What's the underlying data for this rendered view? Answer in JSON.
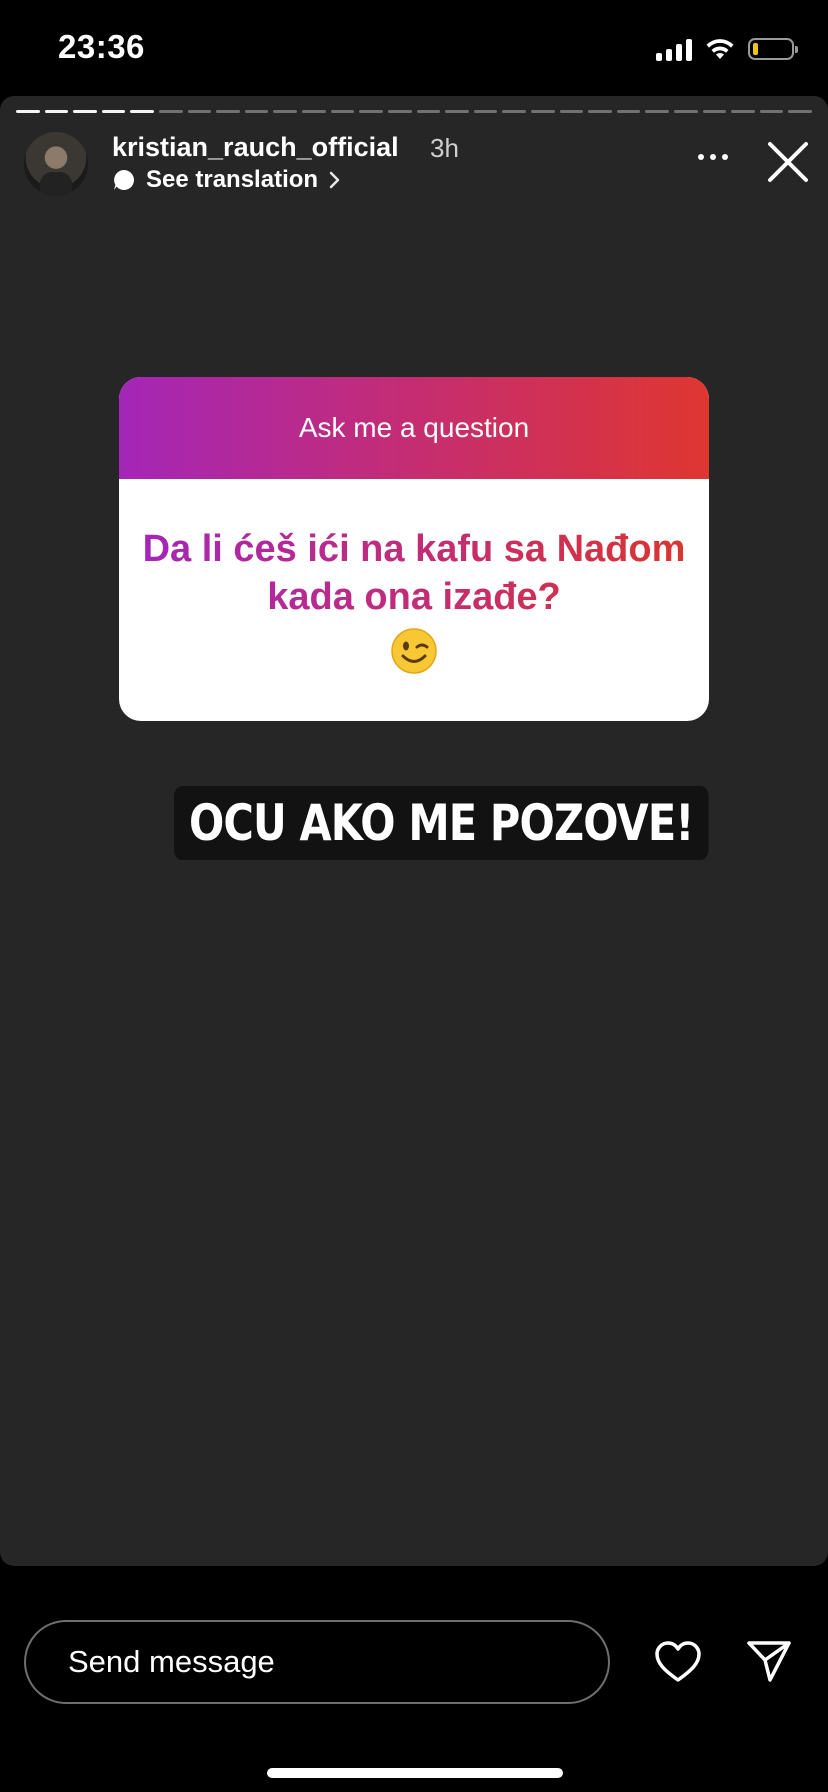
{
  "status_bar": {
    "time": "23:36",
    "icons": [
      "cellular-signal-icon",
      "wifi-icon",
      "battery-icon"
    ]
  },
  "story": {
    "progress_segments": 28,
    "progress_completed": 5,
    "user": {
      "username": "kristian_rauch_official",
      "time_ago": "3h",
      "see_translation": "See translation"
    },
    "icons": [
      "more-icon",
      "close-icon",
      "chevron-right-icon"
    ],
    "question_sticker": {
      "header": "Ask me a question",
      "question": "Da li ćeš ići na kafu sa Nađom kada ona izađe?",
      "emoji": "winking-face-emoji",
      "gradient": [
        "#a426b8",
        "#df3630"
      ]
    },
    "answer": "OCU AKO ME POZOVE!"
  },
  "reply_bar": {
    "placeholder": "Send message",
    "icons": [
      "heart-icon",
      "send-icon"
    ]
  },
  "colors": {
    "story_background": "#262626",
    "screen_background": "#000000"
  }
}
